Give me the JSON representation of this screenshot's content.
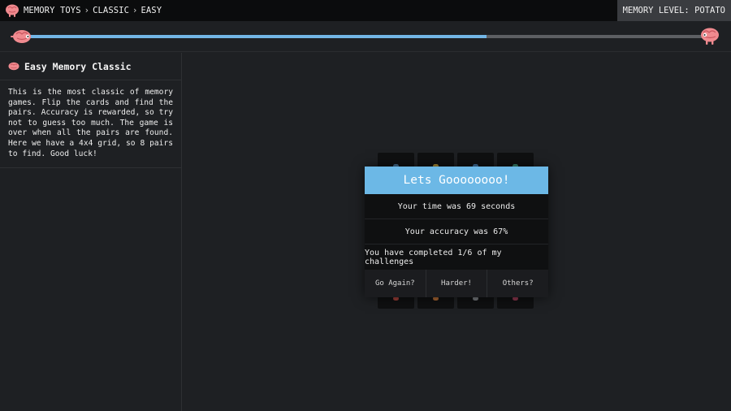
{
  "breadcrumb": {
    "root": "MEMORY TOYS",
    "section": "CLASSIC",
    "current": "EASY",
    "separator": "›"
  },
  "memory_level": "MEMORY LEVEL: POTATO",
  "progress": {
    "fraction": 0.676
  },
  "sidebar": {
    "title": "Easy Memory Classic",
    "description": "This is the most classic of memory games. Flip the cards and find the pairs. Accuracy is rewarded, so try not to guess too much. The game is over when all the pairs are found. Here we have a 4x4 grid, so 8 pairs to find. Good luck!"
  },
  "modal": {
    "title": "Lets Goooooooo!",
    "time": "Your time was 69 seconds",
    "accuracy": "Your accuracy was 67%",
    "challenges": "You have completed 1/6 of my challenges",
    "buttons": {
      "again": "Go Again?",
      "harder": "Harder!",
      "others": "Others?"
    }
  },
  "colors": {
    "accent": "#6cb8e6",
    "brain": "#f08a8f",
    "background": "#1e2023"
  }
}
